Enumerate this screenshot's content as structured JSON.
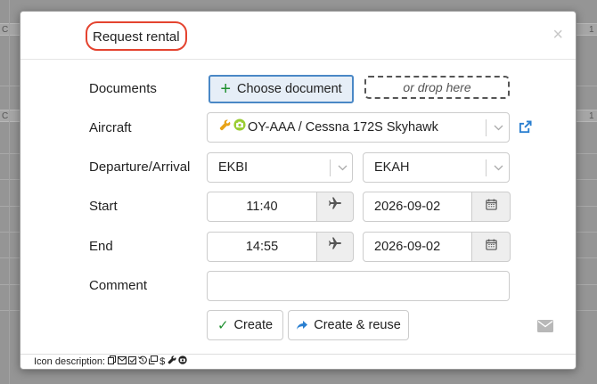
{
  "modal": {
    "title": "Request rental",
    "close_glyph": "×"
  },
  "form": {
    "documents": {
      "label": "Documents",
      "choose_label": "Choose document",
      "drop_label": "or drop here"
    },
    "aircraft": {
      "label": "Aircraft",
      "value": "OY-AAA / Cessna 172S Skyhawk",
      "icons": [
        "wrench-icon",
        "camera-icon"
      ]
    },
    "route": {
      "label": "Departure/Arrival",
      "departure": "EKBI",
      "arrival": "EKAH"
    },
    "start": {
      "label": "Start",
      "time": "11:40",
      "date": "2026-09-02"
    },
    "end": {
      "label": "End",
      "time": "14:55",
      "date": "2026-09-02"
    },
    "comment": {
      "label": "Comment",
      "value": "",
      "placeholder": ""
    }
  },
  "actions": {
    "create_label": "Create",
    "create_reuse_label": "Create & reuse"
  },
  "footer": {
    "label": "Icon description:",
    "icons": [
      "copy-icon",
      "email-icon",
      "checkbox-icon",
      "history-icon",
      "print-icon",
      "dollar-icon",
      "wrench-icon",
      "camera-icon"
    ]
  },
  "background": {
    "col_markers": [
      "C",
      "1",
      "C",
      "1"
    ]
  },
  "colors": {
    "title_outline": "#e4432f",
    "primary_border": "#4a88c6",
    "plus_green": "#1e8f2e",
    "check_green": "#1e8f2e",
    "link_blue": "#2a7fd0",
    "wrench_gold": "#e8a317",
    "camera_green": "#9acd32"
  }
}
